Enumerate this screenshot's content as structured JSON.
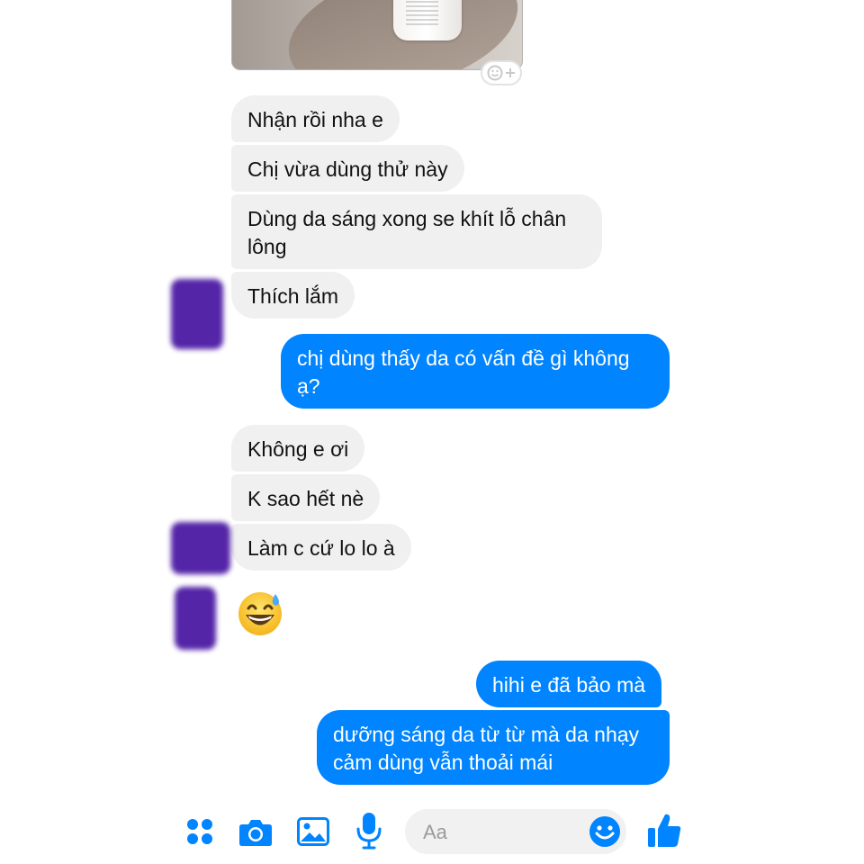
{
  "conversation": {
    "messages": [
      {
        "text": "Nhận rồi nha e"
      },
      {
        "text": "Chị vừa dùng thử này"
      },
      {
        "text": "Dùng da sáng xong se khít lỗ chân lông"
      },
      {
        "text": "Thích lắm"
      },
      {
        "text": "chị dùng thấy da có vấn đề gì không ạ?"
      },
      {
        "text": "Không e ơi"
      },
      {
        "text": "K sao hết nè"
      },
      {
        "text": "Làm c cứ lo lo à"
      },
      {
        "text": "hihi e đã bảo mà"
      },
      {
        "text": "dưỡng sáng da từ từ mà da nhạy cảm dùng vẫn thoải mái"
      }
    ],
    "emoji_icon": "grinning-face-with-sweat-icon",
    "attachment_icon": "photo-attachment"
  },
  "composer": {
    "placeholder": "Aa",
    "icons": [
      "more-apps-icon",
      "camera-icon",
      "image-icon",
      "microphone-icon",
      "emoji-icon",
      "thumbs-up-icon"
    ]
  },
  "colors": {
    "outgoing": "#0084ff",
    "incoming": "#f0f0f0",
    "accent": "#0084ff"
  }
}
